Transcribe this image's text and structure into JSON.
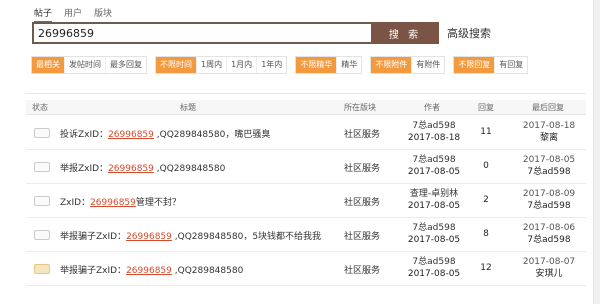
{
  "scope_tabs": [
    {
      "label": "帖子",
      "active": true
    },
    {
      "label": "用户",
      "active": false
    },
    {
      "label": "版块",
      "active": false
    }
  ],
  "search": {
    "value": "26996859",
    "button": "搜 索",
    "advanced": "高级搜索"
  },
  "filters": {
    "sort": [
      {
        "label": "最相关",
        "on": true
      },
      {
        "label": "发帖时间",
        "on": false
      },
      {
        "label": "最多回复",
        "on": false
      }
    ],
    "time": [
      {
        "label": "不限时间",
        "on": true
      },
      {
        "label": "1周内",
        "on": false
      },
      {
        "label": "1月内",
        "on": false
      },
      {
        "label": "1年内",
        "on": false
      }
    ],
    "digest": [
      {
        "label": "不限精华",
        "on": true
      },
      {
        "label": "精华",
        "on": false
      }
    ],
    "attach": [
      {
        "label": "不限附件",
        "on": true
      },
      {
        "label": "有附件",
        "on": false
      }
    ],
    "reply": [
      {
        "label": "不限回复",
        "on": true
      },
      {
        "label": "有回复",
        "on": false
      }
    ]
  },
  "columns": {
    "status": "状态",
    "title": "标题",
    "forum": "所在版块",
    "author": "作者",
    "replies": "回复",
    "last": "最后回复"
  },
  "rows": [
    {
      "title_pre": "投诉ZxID：",
      "title_hl": "26996859",
      "title_post": " ,QQ289848580，嘴巴骚臭",
      "forum": "社区服务",
      "author": "7总ad598",
      "author_date": "2017-08-18",
      "replies": "11",
      "last_date": "2017-08-18",
      "last_user": "黎离",
      "icon_alt": false
    },
    {
      "title_pre": "举报ZxID：",
      "title_hl": "26996859",
      "title_post": " ,QQ289848580",
      "forum": "社区服务",
      "author": "7总ad598",
      "author_date": "2017-08-05",
      "replies": "0",
      "last_date": "2017-08-05",
      "last_user": "7总ad598",
      "icon_alt": false
    },
    {
      "title_pre": "ZxID：",
      "title_hl": "26996859",
      "title_post": "管理不封？",
      "forum": "社区服务",
      "author": "查理-卓别林",
      "author_date": "2017-08-05",
      "replies": "2",
      "last_date": "2017-08-09",
      "last_user": "7总ad598",
      "icon_alt": false
    },
    {
      "title_pre": "举报骗子ZxID：",
      "title_hl": "26996859",
      "title_post": " ,QQ289848580，5块钱都不给我我",
      "forum": "社区服务",
      "author": "7总ad598",
      "author_date": "2017-08-05",
      "replies": "8",
      "last_date": "2017-08-06",
      "last_user": "7总ad598",
      "icon_alt": false
    },
    {
      "title_pre": "举报骗子ZxID：",
      "title_hl": "26996859",
      "title_post": " ,QQ289848580",
      "forum": "社区服务",
      "author": "7总ad598",
      "author_date": "2017-08-05",
      "replies": "12",
      "last_date": "2017-08-07",
      "last_user": "安琪儿",
      "icon_alt": true
    }
  ]
}
